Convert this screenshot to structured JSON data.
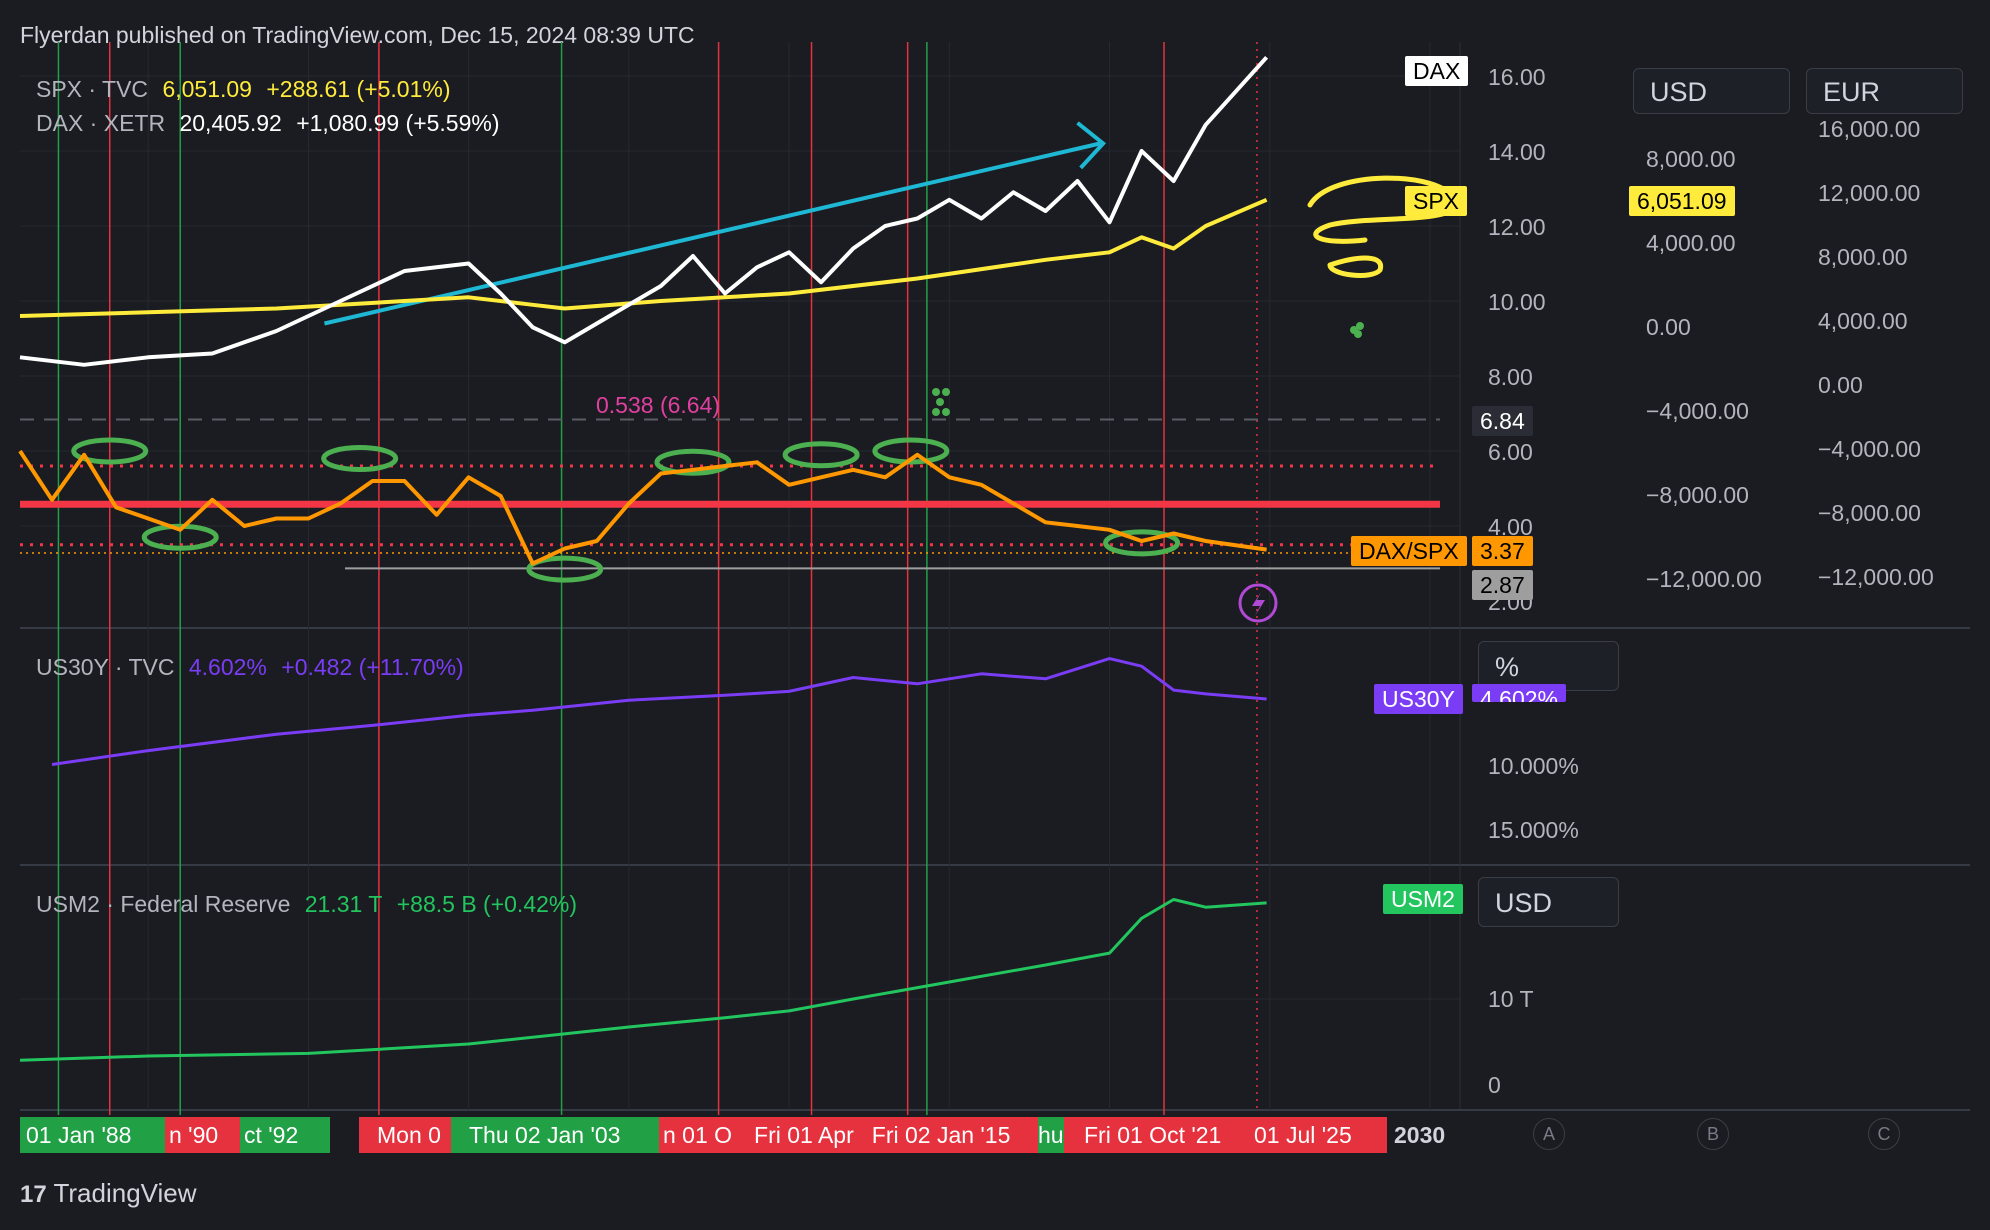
{
  "header": {
    "publisher": "Flyerdan published on TradingView.com, Dec 15, 2024 08:39 UTC"
  },
  "legend": {
    "spx_name": "SPX · TVC",
    "spx_value": "6,051.09",
    "spx_change": "+288.61 (+5.01%)",
    "dax_name": "DAX · XETR",
    "dax_value": "20,405.92",
    "dax_change": "+1,080.99 (+5.59%)",
    "us30y_name": "US30Y · TVC",
    "us30y_value": "4.602%",
    "us30y_change": "+0.482 (+11.70%)",
    "usm2_name": "USM2 · Federal Reserve",
    "usm2_value": "21.31 T",
    "usm2_change": "+88.5 B (+0.42%)"
  },
  "currency_buttons": {
    "usd": "USD",
    "eur": "EUR",
    "pct": "%",
    "usd2": "USD"
  },
  "axes": {
    "ratio_ticks": [
      "16.00",
      "14.00",
      "12.00",
      "10.00",
      "8.00",
      "6.00",
      "4.00",
      "2.00"
    ],
    "spx_ticks": [
      "8,000.00",
      "4,000.00",
      "0.00",
      "−4,000.00",
      "−8,000.00",
      "−12,000.00"
    ],
    "dax_ticks": [
      "16,000.00",
      "12,000.00",
      "8,000.00",
      "4,000.00",
      "0.00",
      "−4,000.00",
      "−8,000.00",
      "−12,000.00"
    ],
    "us30y_ticks": [
      "10.000%",
      "15.000%"
    ],
    "usm2_ticks": [
      "10 T",
      "0"
    ]
  },
  "tags": {
    "dax": "DAX",
    "spx": "SPX",
    "spx_price": "6,051.09",
    "ratio_level": "6.84",
    "ratio_name": "DAX/SPX",
    "ratio_value": "3.37",
    "ratio_low": "2.87",
    "us30y": "US30Y",
    "us30y_price": "4.602%",
    "usm2": "USM2",
    "overlap_label": "0.538 (6.64)"
  },
  "x_labels": [
    "01 Jan '88",
    "n '90",
    "ct '92",
    "Mon 0",
    "Thu 02 Jan '03",
    "n 01 O",
    "Fri 01 Apr",
    "Fri 02 Jan '15",
    "hu",
    "Fri 01 Oct '21",
    "01 Jul '25",
    "2030"
  ],
  "pane_buttons": [
    "A",
    "B",
    "C"
  ],
  "footer": {
    "brand": "TradingView"
  },
  "colors": {
    "background": "#1a1c21",
    "spx": "#ffeb3b",
    "dax": "#ffffff",
    "ratio": "#ff9800",
    "us30y": "#7b3cf5",
    "usm2": "#22c55e",
    "red_line": "#f23645",
    "cyan_arrow": "#1fb8d4",
    "green_marker": "#4caf50"
  },
  "chart_data": [
    {
      "type": "line",
      "title": "",
      "series": [
        {
          "name": "DAX",
          "x": [
            1986,
            1988,
            1990,
            1992,
            1994,
            1996,
            1998,
            2000,
            2001,
            2002,
            2003,
            2004,
            2006,
            2007,
            2008,
            2009,
            2010,
            2011,
            2012,
            2013,
            2014,
            2015,
            2016,
            2017,
            2018,
            2019,
            2020,
            2021,
            2022,
            2023,
            2024.9
          ],
          "values": [
            8.5,
            8.3,
            8.5,
            8.6,
            9.2,
            10.0,
            10.8,
            11.0,
            10.2,
            9.3,
            8.9,
            9.4,
            10.4,
            11.2,
            10.2,
            10.9,
            11.3,
            10.5,
            11.4,
            12.0,
            12.2,
            12.7,
            12.2,
            12.9,
            12.4,
            13.2,
            12.1,
            14.0,
            13.2,
            14.7,
            16.5
          ]
        },
        {
          "name": "SPX",
          "x": [
            1986,
            1990,
            1994,
            1998,
            2000,
            2002,
            2003,
            2006,
            2008,
            2010,
            2014,
            2018,
            2020,
            2021,
            2022,
            2023,
            2024.9
          ],
          "values": [
            9.6,
            9.7,
            9.8,
            10.0,
            10.1,
            9.9,
            9.8,
            10.0,
            10.1,
            10.2,
            10.6,
            11.1,
            11.3,
            11.7,
            11.4,
            12.0,
            12.7
          ]
        }
      ]
    },
    {
      "type": "line",
      "series": [
        {
          "name": "DAX/SPX",
          "x": [
            1986,
            1987,
            1988,
            1989,
            1990,
            1991,
            1992,
            1993,
            1994,
            1995,
            1996,
            1997,
            1998,
            1999,
            2000,
            2001,
            2002,
            2003,
            2004,
            2005,
            2006,
            2007,
            2008,
            2009,
            2010,
            2011,
            2012,
            2013,
            2014,
            2015,
            2016,
            2017,
            2018,
            2019,
            2020,
            2021,
            2022,
            2023,
            2024.9
          ],
          "values": [
            6.0,
            4.7,
            5.9,
            4.5,
            4.2,
            3.9,
            4.7,
            4.0,
            4.2,
            4.2,
            4.6,
            5.2,
            5.2,
            4.3,
            5.3,
            4.8,
            3.0,
            3.4,
            3.6,
            4.6,
            5.4,
            5.5,
            5.6,
            5.7,
            5.1,
            5.3,
            5.5,
            5.3,
            5.9,
            5.3,
            5.1,
            4.6,
            4.1,
            4.0,
            3.9,
            3.6,
            3.8,
            3.6,
            3.37
          ]
        }
      ],
      "levels": {
        "last": 3.37,
        "dashed_grey": 6.84,
        "low_line": 2.87
      }
    },
    {
      "type": "line",
      "series": [
        {
          "name": "US30Y",
          "x": [
            1987,
            1990,
            1994,
            1997,
            2000,
            2002,
            2005,
            2008,
            2010,
            2012,
            2014,
            2016,
            2018,
            2020,
            2021,
            2022,
            2023,
            2024.9
          ],
          "values": [
            9.8,
            8.7,
            7.4,
            6.7,
            5.9,
            5.5,
            4.7,
            4.3,
            4.0,
            2.9,
            3.4,
            2.6,
            3.0,
            1.4,
            2.0,
            3.9,
            4.2,
            4.602
          ]
        }
      ]
    },
    {
      "type": "line",
      "series": [
        {
          "name": "USM2",
          "x": [
            1986,
            1990,
            1995,
            2000,
            2005,
            2008,
            2010,
            2012,
            2015,
            2018,
            2020,
            2021,
            2022,
            2023,
            2024.9
          ],
          "values": [
            2.8,
            3.3,
            3.6,
            4.7,
            6.7,
            7.8,
            8.6,
            10.0,
            12.0,
            14.0,
            15.4,
            19.5,
            21.7,
            20.8,
            21.31
          ]
        }
      ]
    }
  ]
}
